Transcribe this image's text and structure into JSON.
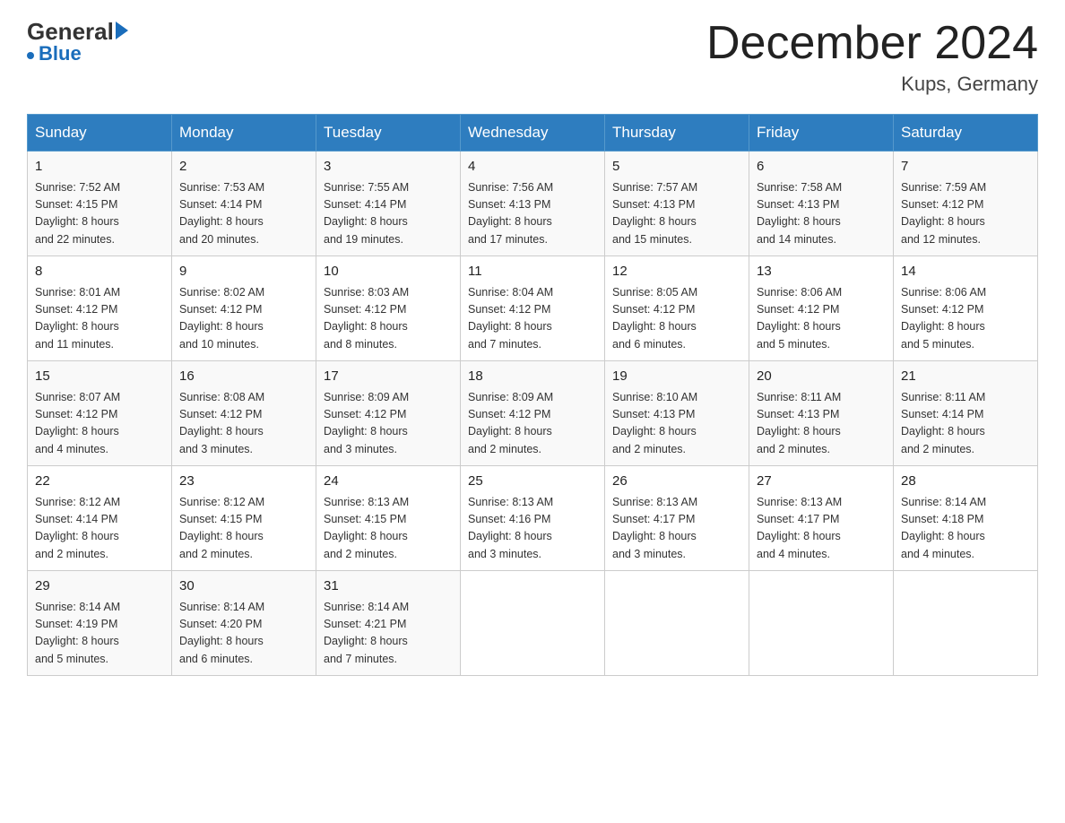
{
  "header": {
    "logo": {
      "general": "General",
      "blue": "Blue"
    },
    "title": "December 2024",
    "location": "Kups, Germany"
  },
  "days_of_week": [
    "Sunday",
    "Monday",
    "Tuesday",
    "Wednesday",
    "Thursday",
    "Friday",
    "Saturday"
  ],
  "weeks": [
    [
      {
        "day": "1",
        "sunrise": "7:52 AM",
        "sunset": "4:15 PM",
        "daylight": "8 hours and 22 minutes."
      },
      {
        "day": "2",
        "sunrise": "7:53 AM",
        "sunset": "4:14 PM",
        "daylight": "8 hours and 20 minutes."
      },
      {
        "day": "3",
        "sunrise": "7:55 AM",
        "sunset": "4:14 PM",
        "daylight": "8 hours and 19 minutes."
      },
      {
        "day": "4",
        "sunrise": "7:56 AM",
        "sunset": "4:13 PM",
        "daylight": "8 hours and 17 minutes."
      },
      {
        "day": "5",
        "sunrise": "7:57 AM",
        "sunset": "4:13 PM",
        "daylight": "8 hours and 15 minutes."
      },
      {
        "day": "6",
        "sunrise": "7:58 AM",
        "sunset": "4:13 PM",
        "daylight": "8 hours and 14 minutes."
      },
      {
        "day": "7",
        "sunrise": "7:59 AM",
        "sunset": "4:12 PM",
        "daylight": "8 hours and 12 minutes."
      }
    ],
    [
      {
        "day": "8",
        "sunrise": "8:01 AM",
        "sunset": "4:12 PM",
        "daylight": "8 hours and 11 minutes."
      },
      {
        "day": "9",
        "sunrise": "8:02 AM",
        "sunset": "4:12 PM",
        "daylight": "8 hours and 10 minutes."
      },
      {
        "day": "10",
        "sunrise": "8:03 AM",
        "sunset": "4:12 PM",
        "daylight": "8 hours and 8 minutes."
      },
      {
        "day": "11",
        "sunrise": "8:04 AM",
        "sunset": "4:12 PM",
        "daylight": "8 hours and 7 minutes."
      },
      {
        "day": "12",
        "sunrise": "8:05 AM",
        "sunset": "4:12 PM",
        "daylight": "8 hours and 6 minutes."
      },
      {
        "day": "13",
        "sunrise": "8:06 AM",
        "sunset": "4:12 PM",
        "daylight": "8 hours and 5 minutes."
      },
      {
        "day": "14",
        "sunrise": "8:06 AM",
        "sunset": "4:12 PM",
        "daylight": "8 hours and 5 minutes."
      }
    ],
    [
      {
        "day": "15",
        "sunrise": "8:07 AM",
        "sunset": "4:12 PM",
        "daylight": "8 hours and 4 minutes."
      },
      {
        "day": "16",
        "sunrise": "8:08 AM",
        "sunset": "4:12 PM",
        "daylight": "8 hours and 3 minutes."
      },
      {
        "day": "17",
        "sunrise": "8:09 AM",
        "sunset": "4:12 PM",
        "daylight": "8 hours and 3 minutes."
      },
      {
        "day": "18",
        "sunrise": "8:09 AM",
        "sunset": "4:12 PM",
        "daylight": "8 hours and 2 minutes."
      },
      {
        "day": "19",
        "sunrise": "8:10 AM",
        "sunset": "4:13 PM",
        "daylight": "8 hours and 2 minutes."
      },
      {
        "day": "20",
        "sunrise": "8:11 AM",
        "sunset": "4:13 PM",
        "daylight": "8 hours and 2 minutes."
      },
      {
        "day": "21",
        "sunrise": "8:11 AM",
        "sunset": "4:14 PM",
        "daylight": "8 hours and 2 minutes."
      }
    ],
    [
      {
        "day": "22",
        "sunrise": "8:12 AM",
        "sunset": "4:14 PM",
        "daylight": "8 hours and 2 minutes."
      },
      {
        "day": "23",
        "sunrise": "8:12 AM",
        "sunset": "4:15 PM",
        "daylight": "8 hours and 2 minutes."
      },
      {
        "day": "24",
        "sunrise": "8:13 AM",
        "sunset": "4:15 PM",
        "daylight": "8 hours and 2 minutes."
      },
      {
        "day": "25",
        "sunrise": "8:13 AM",
        "sunset": "4:16 PM",
        "daylight": "8 hours and 3 minutes."
      },
      {
        "day": "26",
        "sunrise": "8:13 AM",
        "sunset": "4:17 PM",
        "daylight": "8 hours and 3 minutes."
      },
      {
        "day": "27",
        "sunrise": "8:13 AM",
        "sunset": "4:17 PM",
        "daylight": "8 hours and 4 minutes."
      },
      {
        "day": "28",
        "sunrise": "8:14 AM",
        "sunset": "4:18 PM",
        "daylight": "8 hours and 4 minutes."
      }
    ],
    [
      {
        "day": "29",
        "sunrise": "8:14 AM",
        "sunset": "4:19 PM",
        "daylight": "8 hours and 5 minutes."
      },
      {
        "day": "30",
        "sunrise": "8:14 AM",
        "sunset": "4:20 PM",
        "daylight": "8 hours and 6 minutes."
      },
      {
        "day": "31",
        "sunrise": "8:14 AM",
        "sunset": "4:21 PM",
        "daylight": "8 hours and 7 minutes."
      },
      null,
      null,
      null,
      null
    ]
  ],
  "labels": {
    "sunrise": "Sunrise:",
    "sunset": "Sunset:",
    "daylight": "Daylight:"
  }
}
